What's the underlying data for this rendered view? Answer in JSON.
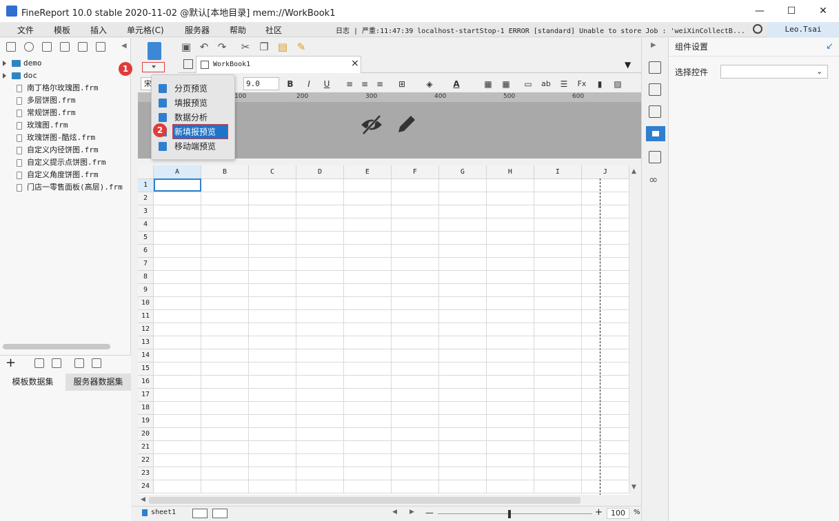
{
  "window": {
    "title": "FineReport 10.0 stable 2020-11-02 @默认[本地目录]    mem://WorkBook1",
    "minimize": "—",
    "maximize": "☐",
    "close": "✕"
  },
  "menubar": {
    "items": [
      "文件",
      "模板",
      "插入",
      "单元格(C)",
      "服务器",
      "帮助",
      "社区"
    ],
    "log": "日志 | 严重:11:47:39 localhost-startStop-1 ERROR [standard] Unable to store Job : 'weiXinCollectB...",
    "user": "Leo.Tsai"
  },
  "filetree": {
    "folders": [
      "demo",
      "doc"
    ],
    "files": [
      "南丁格尔玫瑰图.frm",
      "多层饼图.frm",
      "常规饼图.frm",
      "玫瑰图.frm",
      "玫瑰饼图-酷炫.frm",
      "自定义内径饼图.frm",
      "自定义提示点饼图.frm",
      "自定义角度饼图.frm",
      "门店一零售面板(高层).frm"
    ]
  },
  "datasets": {
    "tabs": [
      "模板数据集",
      "服务器数据集"
    ]
  },
  "workbook": {
    "tab_label": "WorkBook1",
    "close": "×",
    "font_size": "9.0",
    "font_name": "宋"
  },
  "dropdown": {
    "items": [
      "分页预览",
      "填报预览",
      "数据分析",
      "新填报预览",
      "移动端预览"
    ],
    "selected_index": 3
  },
  "badges": [
    "1",
    "2"
  ],
  "ruler": {
    "ticks": [
      "100",
      "200",
      "300",
      "400",
      "500",
      "600"
    ]
  },
  "sheet": {
    "columns": [
      "A",
      "B",
      "C",
      "D",
      "E",
      "F",
      "G",
      "H",
      "I",
      "J"
    ],
    "rows": [
      "1",
      "2",
      "3",
      "4",
      "5",
      "6",
      "7",
      "8",
      "9",
      "10",
      "11",
      "12",
      "13",
      "14",
      "15",
      "16",
      "17",
      "18",
      "19",
      "20",
      "21",
      "22",
      "23",
      "24"
    ],
    "selected_cell": "A1"
  },
  "statusbar": {
    "sheet_tab": "sheet1",
    "zoom": "100",
    "zoom_unit": "%",
    "minus": "—",
    "plus": "+"
  },
  "rightpanel": {
    "title": "组件设置",
    "select_label": "选择控件",
    "select_value": ""
  },
  "colors": {
    "accent": "#2f7fcf",
    "highlight_border": "#e03b3b",
    "selection": "#1f73c9"
  }
}
